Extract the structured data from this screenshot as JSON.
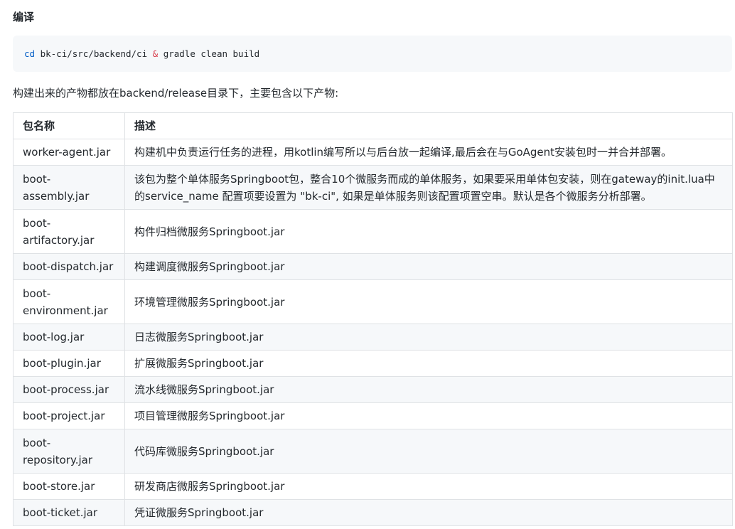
{
  "section": {
    "title": "编译"
  },
  "code": {
    "cmd": "cd",
    "path": " bk-ci/src/backend/ci ",
    "amp": "&",
    "rest": " gradle clean build"
  },
  "intro_text": "构建出来的产物都放在backend/release目录下，主要包含以下产物:",
  "table": {
    "headers": [
      "包名称",
      "描述"
    ],
    "rows": [
      {
        "name": "worker-agent.jar",
        "desc": "构建机中负责运行任务的进程，用kotlin编写所以与后台放一起编译,最后会在与GoAgent安装包时一并合并部署。"
      },
      {
        "name": "boot-assembly.jar",
        "desc": "该包为整个单体服务Springboot包，整合10个微服务而成的单体服务，如果要采用单体包安装，则在gateway的init.lua中的service_name 配置项要设置为 \"bk-ci\", 如果是单体服务则该配置项置空串。默认是各个微服务分析部署。"
      },
      {
        "name": "boot-artifactory.jar",
        "desc": "构件归档微服务Springboot.jar"
      },
      {
        "name": "boot-dispatch.jar",
        "desc": "构建调度微服务Springboot.jar"
      },
      {
        "name": "boot-environment.jar",
        "desc": "环境管理微服务Springboot.jar"
      },
      {
        "name": "boot-log.jar",
        "desc": "日志微服务Springboot.jar"
      },
      {
        "name": "boot-plugin.jar",
        "desc": "扩展微服务Springboot.jar"
      },
      {
        "name": "boot-process.jar",
        "desc": "流水线微服务Springboot.jar"
      },
      {
        "name": "boot-project.jar",
        "desc": "项目管理微服务Springboot.jar"
      },
      {
        "name": "boot-repository.jar",
        "desc": "代码库微服务Springboot.jar"
      },
      {
        "name": "boot-store.jar",
        "desc": "研发商店微服务Springboot.jar"
      },
      {
        "name": "boot-ticket.jar",
        "desc": "凭证微服务Springboot.jar"
      }
    ]
  }
}
